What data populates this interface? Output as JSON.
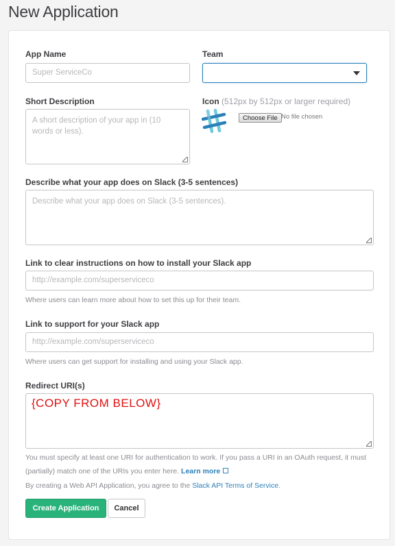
{
  "page": {
    "title": "New Application"
  },
  "form": {
    "app_name": {
      "label": "App Name",
      "placeholder": "Super ServiceCo",
      "value": ""
    },
    "team": {
      "label": "Team",
      "selected": ""
    },
    "short_description": {
      "label": "Short Description",
      "placeholder": "A short description of your app in (10 words or less)."
    },
    "icon": {
      "label": "Icon",
      "hint": "(512px by 512px or larger required)",
      "choose_file_label": "Choose File",
      "no_file_text": "No file chosen",
      "icon_name": "slack-hash-icon"
    },
    "describe": {
      "label": "Describe what your app does on Slack (3-5 sentences)",
      "placeholder": "Describe what your app does on Slack (3-5 sentences)."
    },
    "install_link": {
      "label": "Link to clear instructions on how to install your Slack app",
      "placeholder": "http://example.com/superserviceco",
      "help": "Where users can learn more about how to set this up for their team."
    },
    "support_link": {
      "label": "Link to support for your Slack app",
      "placeholder": "http://example.com/superserviceco",
      "help": "Where users can get support for installing and using your Slack app."
    },
    "redirect": {
      "label": "Redirect URI(s)",
      "value": "{COPY FROM BELOW}",
      "help_part1": "You must specify at least one URI for authentication to work. If you pass a URI in an OAuth request, it must (partially) match one of the URIs you enter here.",
      "learn_more": "Learn more"
    },
    "terms": {
      "prefix": "By creating a Web API Application, you agree to the",
      "link": "Slack API Terms of Service",
      "suffix": "."
    },
    "buttons": {
      "create": "Create Application",
      "cancel": "Cancel"
    }
  },
  "colors": {
    "accent": "#2a80b9",
    "primary_button": "#2ab27b",
    "redirect_text": "#e01010"
  }
}
